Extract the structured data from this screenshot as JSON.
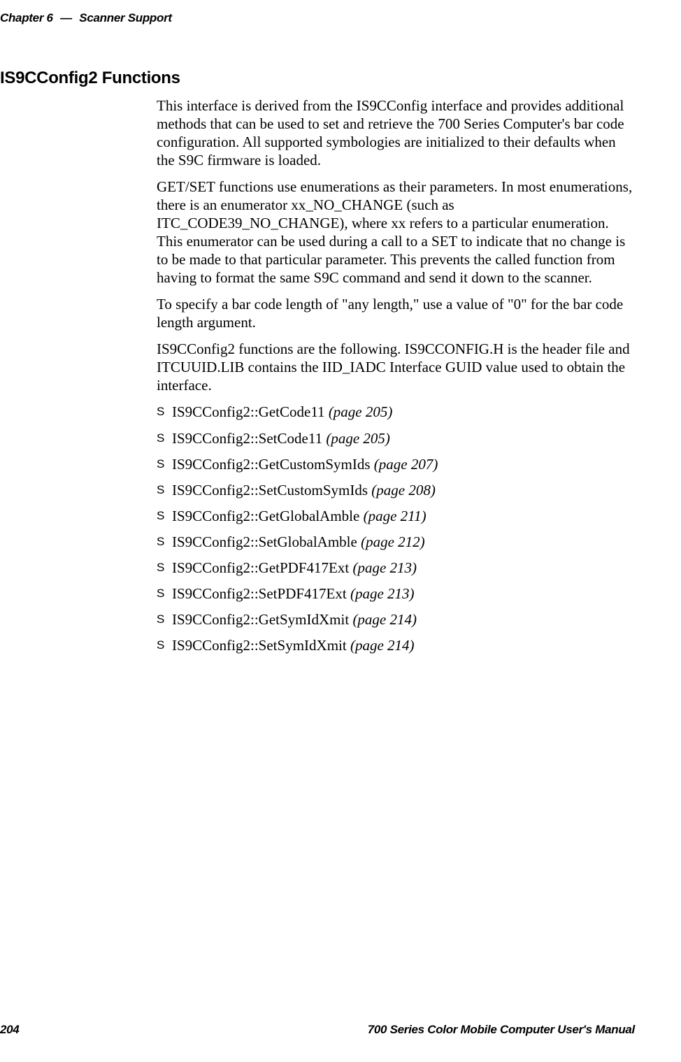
{
  "header": {
    "chapter": "Chapter 6",
    "dash": "—",
    "title": "Scanner Support"
  },
  "section_title": "IS9CConfig2 Functions",
  "paragraphs": {
    "p1": "This interface is derived from the IS9CConfig interface and provides additional methods that can be used to set and retrieve the 700 Series Computer's bar code configuration. All supported symbologies are initialized to their defaults when the S9C firmware is loaded.",
    "p2": "GET/SET functions use enumerations as their parameters. In most enumerations, there is an enumerator xx_NO_CHANGE (such as ITC_CODE39_NO_CHANGE), where xx refers to a particular enumeration. This enumerator can be used during a call to a SET to indicate that no change is to be made to that particular parameter. This prevents the called function from having to format the same S9C command and send it down to the scanner.",
    "p3": "To specify a bar code length of \"any length,\" use a value of \"0\" for the bar code length argument.",
    "p4": "IS9CConfig2 functions are the following. IS9CCONFIG.H is the header file and ITCUUID.LIB contains the IID_IADC Interface GUID value used to obtain the interface."
  },
  "bullets": [
    {
      "name": "IS9CConfig2::GetCode11 ",
      "pageref": "(page 205)"
    },
    {
      "name": "IS9CConfig2::SetCode11 ",
      "pageref": "(page 205)"
    },
    {
      "name": "IS9CConfig2::GetCustomSymIds ",
      "pageref": "(page 207)"
    },
    {
      "name": "IS9CConfig2::SetCustomSymIds ",
      "pageref": "(page 208)"
    },
    {
      "name": "IS9CConfig2::GetGlobalAmble ",
      "pageref": "(page 211)"
    },
    {
      "name": "IS9CConfig2::SetGlobalAmble ",
      "pageref": "(page 212)"
    },
    {
      "name": "IS9CConfig2::GetPDF417Ext ",
      "pageref": "(page 213)"
    },
    {
      "name": "IS9CConfig2::SetPDF417Ext ",
      "pageref": "(page 213)"
    },
    {
      "name": "IS9CConfig2::GetSymIdXmit ",
      "pageref": "(page 214)"
    },
    {
      "name": "IS9CConfig2::SetSymIdXmit ",
      "pageref": "(page 214)"
    }
  ],
  "footer": {
    "pagenum": "204",
    "title": "700 Series Color Mobile Computer User's Manual"
  }
}
